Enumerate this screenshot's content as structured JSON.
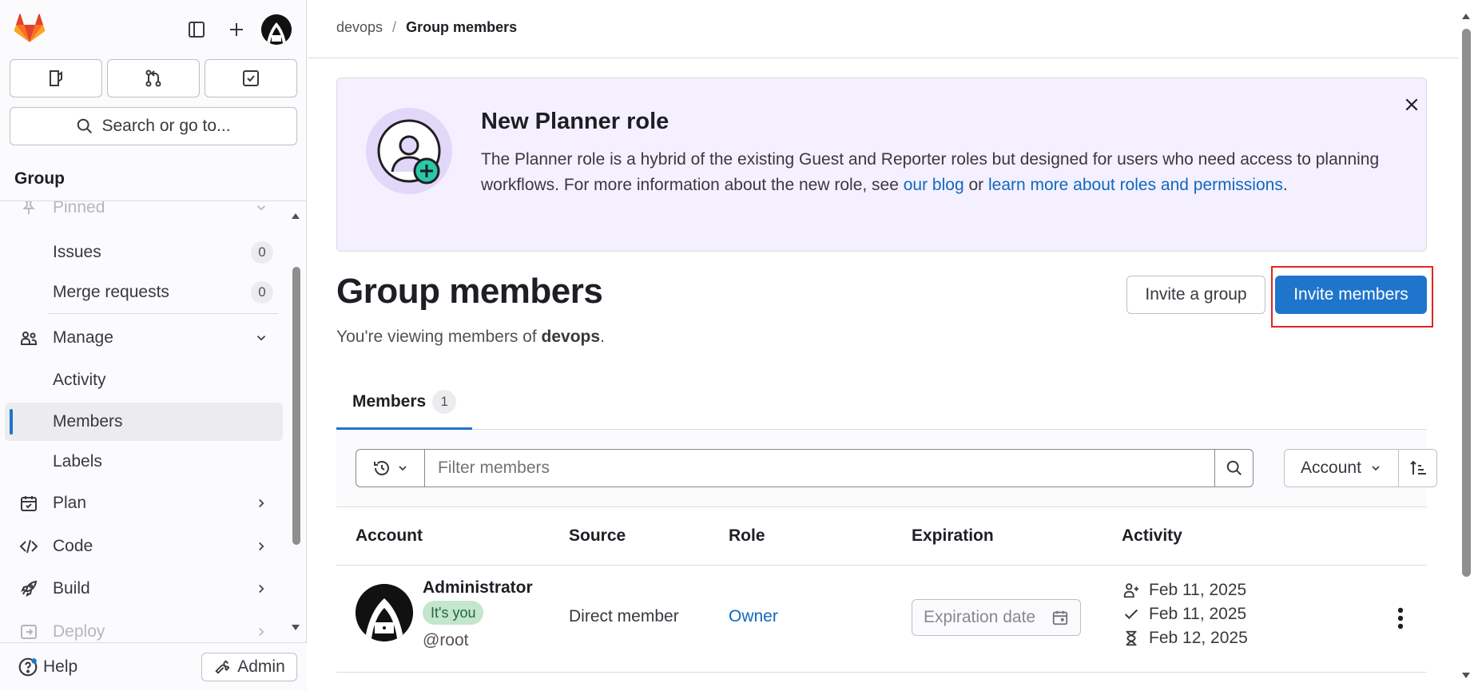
{
  "sidebar": {
    "search_label": "Search or go to...",
    "section_title": "Group",
    "pinned_label": "Pinned",
    "items": [
      {
        "label": "Issues",
        "count": "0"
      },
      {
        "label": "Merge requests",
        "count": "0"
      },
      {
        "label": "Manage"
      },
      {
        "label": "Activity"
      },
      {
        "label": "Members"
      },
      {
        "label": "Labels"
      },
      {
        "label": "Plan"
      },
      {
        "label": "Code"
      },
      {
        "label": "Build"
      },
      {
        "label": "Deploy"
      }
    ],
    "help_label": "Help",
    "admin_label": "Admin"
  },
  "breadcrumb": {
    "group": "devops",
    "separator": "/",
    "current": "Group members"
  },
  "banner": {
    "title": "New Planner role",
    "body_prefix": "The Planner role is a hybrid of the existing Guest and Reporter roles but designed for users who need access to planning workflows. For more information about the new role, see ",
    "link_blog": "our blog",
    "body_or": " or ",
    "link_learn": "learn more about roles and permissions",
    "body_suffix": "."
  },
  "page": {
    "title": "Group members",
    "subtitle_prefix": "You're viewing members of ",
    "subtitle_group": "devops",
    "subtitle_suffix": ".",
    "invite_group_label": "Invite a group",
    "invite_members_label": "Invite members"
  },
  "tabs": [
    {
      "label": "Members",
      "count": "1"
    }
  ],
  "filter": {
    "placeholder": "Filter members",
    "sort_label": "Account"
  },
  "table": {
    "headers": [
      "Account",
      "Source",
      "Role",
      "Expiration",
      "Activity"
    ],
    "rows": [
      {
        "name": "Administrator",
        "badge": "It's you",
        "handle": "@root",
        "source": "Direct member",
        "role": "Owner",
        "expiration_placeholder": "Expiration date",
        "activity": {
          "access_granted": "Feb 11, 2025",
          "user_created": "Feb 11, 2025",
          "last_activity": "Feb 12, 2025"
        }
      }
    ]
  },
  "colors": {
    "primary": "#1f75cb",
    "link": "#1068bf",
    "banner_bg": "#f4f0ff",
    "badge_bg": "#c3e6cd",
    "highlight": "#e02424"
  }
}
